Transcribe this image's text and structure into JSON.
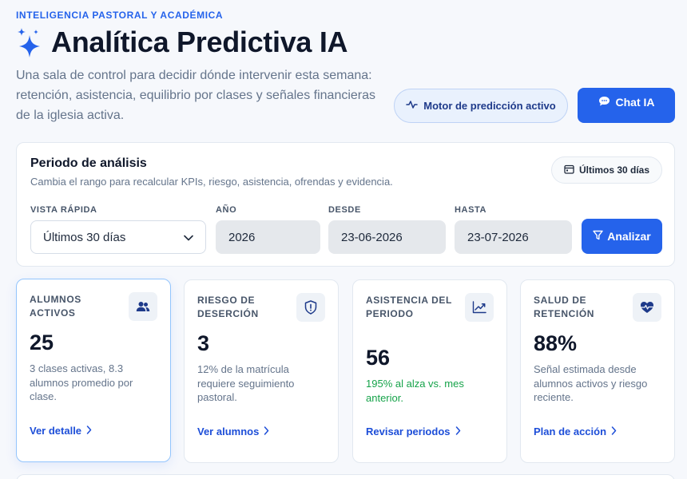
{
  "header": {
    "eyebrow": "INTELIGENCIA PASTORAL Y ACADÉMICA",
    "title": "Analítica Predictiva IA",
    "subtitle": "Una sala de control para decidir dónde intervenir esta semana: retención, asistencia, equilibrio por clases y señales financieras de la iglesia activa.",
    "engine_label": "Motor de predicción activo",
    "chat_label": "Chat IA"
  },
  "period": {
    "title": "Periodo de análisis",
    "description": "Cambia el rango para recalcular KPIs, riesgo, asistencia, ofrendas y evidencia.",
    "range_chip": "Últimos 30 días",
    "fields": {
      "quick_view": {
        "label": "VISTA RÁPIDA",
        "value": "Últimos 30 días"
      },
      "year": {
        "label": "AÑO",
        "value": "2026"
      },
      "from": {
        "label": "DESDE",
        "value": "23-06-2026"
      },
      "to": {
        "label": "HASTA",
        "value": "23-07-2026"
      }
    },
    "analyze_label": "Analizar"
  },
  "kpis": [
    {
      "label": "ALUMNOS ACTIVOS",
      "value": "25",
      "note": "3 clases activas, 8.3 alumnos promedio por clase.",
      "link": "Ver detalle",
      "icon": "users-icon"
    },
    {
      "label": "RIESGO DE DESERCIÓN",
      "value": "3",
      "note": "12% de la matrícula requiere seguimiento pastoral.",
      "link": "Ver alumnos",
      "icon": "shield-alert-icon"
    },
    {
      "label": "ASISTENCIA DEL PERIODO",
      "value": "56",
      "note": "195% al alza vs. mes anterior.",
      "link": "Revisar periodos",
      "icon": "trending-up-icon"
    },
    {
      "label": "SALUD DE RETENCIÓN",
      "value": "88%",
      "note": "Señal estimada desde alumnos activos y riesgo reciente.",
      "link": "Plan de acción",
      "icon": "heart-pulse-icon"
    }
  ],
  "colors": {
    "accent": "#2563eb",
    "positive": "#16a34a",
    "muted": "#64748b"
  }
}
